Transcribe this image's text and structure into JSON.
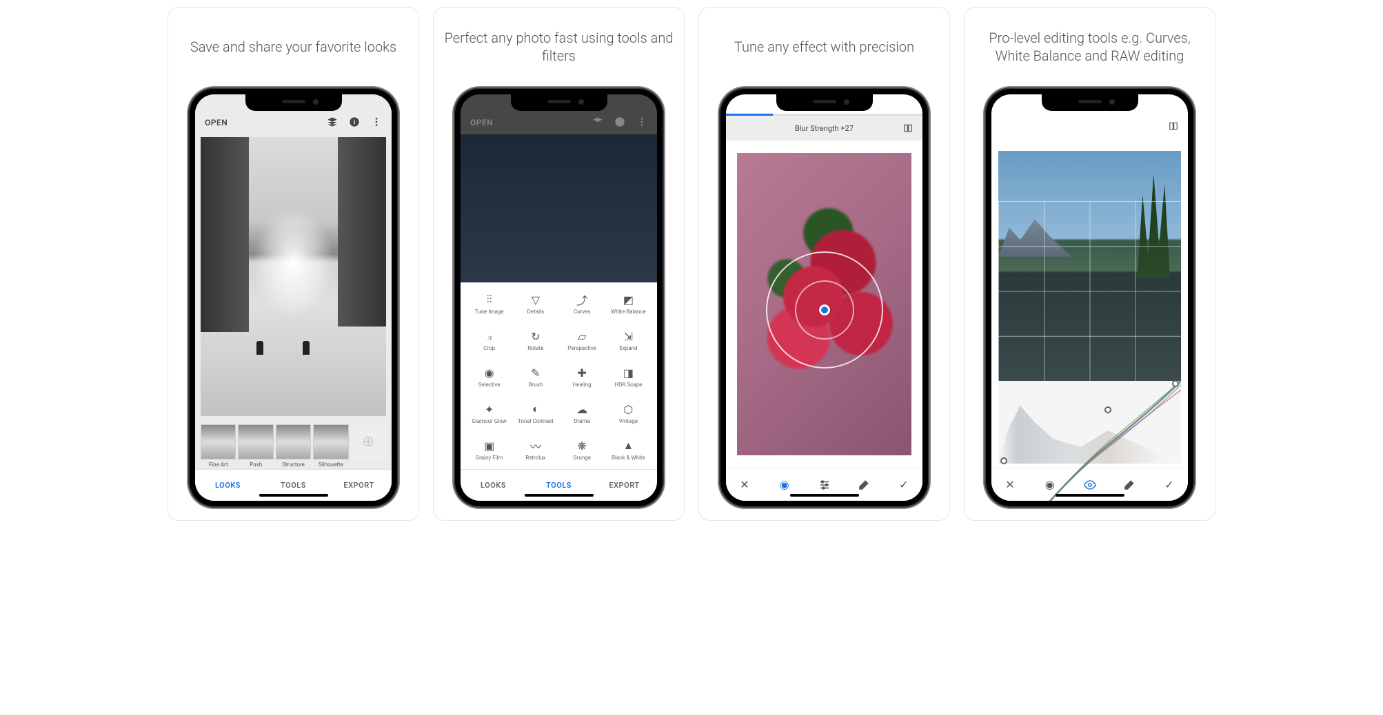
{
  "cards": [
    {
      "caption": "Save and share your favorite looks"
    },
    {
      "caption": "Perfect any photo fast using tools and filters"
    },
    {
      "caption": "Tune any effect with precision"
    },
    {
      "caption": "Pro-level editing tools e.g. Curves, White Balance and RAW editing"
    }
  ],
  "topbar": {
    "open": "OPEN"
  },
  "tabs": {
    "looks": "LOOKS",
    "tools": "TOOLS",
    "export": "EXPORT"
  },
  "looks": [
    {
      "label": "Fine Art"
    },
    {
      "label": "Push"
    },
    {
      "label": "Structure"
    },
    {
      "label": "Silhouette"
    }
  ],
  "tools": [
    {
      "label": "Tune Image",
      "icon": "⫶⫶"
    },
    {
      "label": "Details",
      "icon": "▽"
    },
    {
      "label": "Curves",
      "icon": "⤴"
    },
    {
      "label": "White Balance",
      "icon": "◩"
    },
    {
      "label": "Crop",
      "icon": "⟓"
    },
    {
      "label": "Rotate",
      "icon": "↻"
    },
    {
      "label": "Perspective",
      "icon": "▱"
    },
    {
      "label": "Expand",
      "icon": "⇲"
    },
    {
      "label": "Selective",
      "icon": "◉"
    },
    {
      "label": "Brush",
      "icon": "✎"
    },
    {
      "label": "Healing",
      "icon": "✚"
    },
    {
      "label": "HDR Scape",
      "icon": "◨"
    },
    {
      "label": "Glamour Glow",
      "icon": "✦"
    },
    {
      "label": "Tonal Contrast",
      "icon": "◐"
    },
    {
      "label": "Drama",
      "icon": "☁"
    },
    {
      "label": "Vintage",
      "icon": "⬡"
    },
    {
      "label": "Grainy Film",
      "icon": "▣"
    },
    {
      "label": "Retrolux",
      "icon": "〰"
    },
    {
      "label": "Grunge",
      "icon": "❋"
    },
    {
      "label": "Black & White",
      "icon": "▲"
    }
  ],
  "effect": {
    "label": "Blur Strength +27"
  }
}
